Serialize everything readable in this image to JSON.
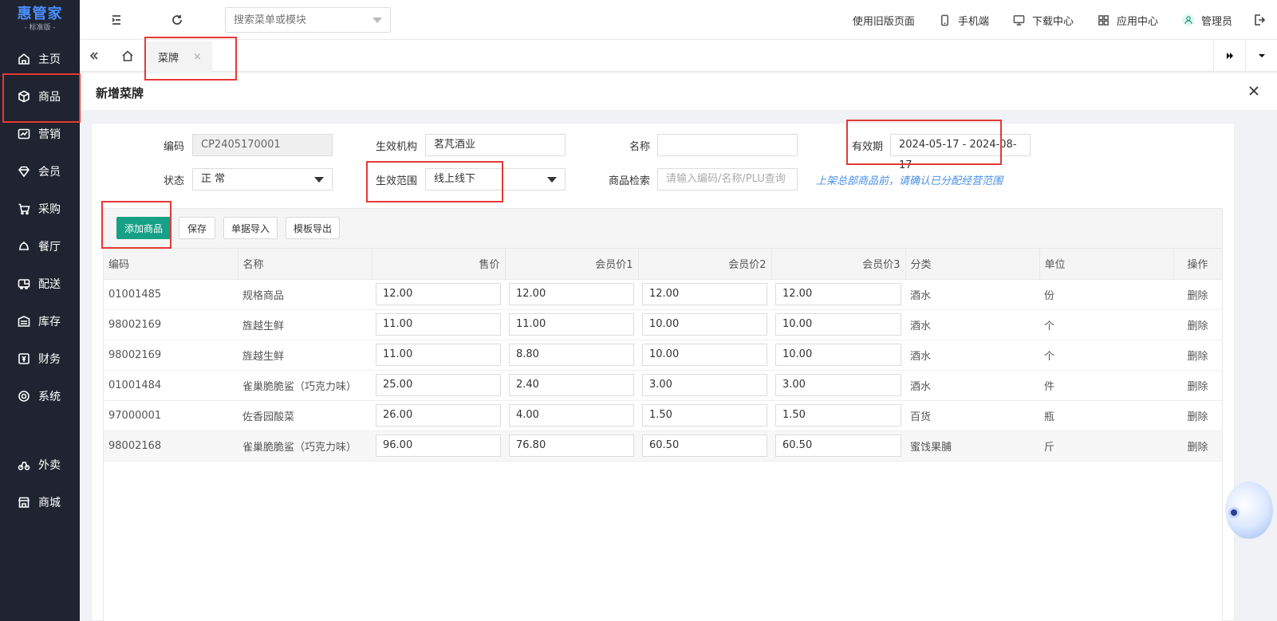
{
  "app": {
    "brand": "惠管家",
    "edition": "- 标准版 -"
  },
  "sidebar": {
    "items": [
      {
        "label": "主页",
        "icon": "home-icon"
      },
      {
        "label": "商品",
        "icon": "box-icon"
      },
      {
        "label": "营销",
        "icon": "chart-icon"
      },
      {
        "label": "会员",
        "icon": "diamond-icon"
      },
      {
        "label": "采购",
        "icon": "cart-icon"
      },
      {
        "label": "餐厅",
        "icon": "bell-icon"
      },
      {
        "label": "配送",
        "icon": "truck-icon"
      },
      {
        "label": "库存",
        "icon": "warehouse-icon"
      },
      {
        "label": "财务",
        "icon": "finance-icon"
      },
      {
        "label": "系统",
        "icon": "settings-icon"
      },
      {
        "label": "外卖",
        "icon": "bike-icon"
      },
      {
        "label": "商城",
        "icon": "store-icon"
      }
    ]
  },
  "topbar": {
    "menu_search_placeholder": "搜索菜单或模块",
    "links": {
      "old_version": "使用旧版页面",
      "mobile": "手机端",
      "download": "下载中心",
      "apps": "应用中心",
      "user": "管理员"
    }
  },
  "tabs": [
    {
      "label": "菜牌",
      "close": "×"
    }
  ],
  "panel": {
    "title": "新增菜牌"
  },
  "form": {
    "code_label": "编码",
    "code_value": "CP2405170001",
    "org_label": "生效机构",
    "org_value": "茗芃酒业",
    "name_label": "名称",
    "name_value": "",
    "validity_label": "有效期",
    "validity_value": "2024-05-17 - 2024-08-17",
    "status_label": "状态",
    "status_value": "正 常",
    "scope_label": "生效范围",
    "scope_value": "线上线下",
    "search_label": "商品检索",
    "search_placeholder": "请输入编码/名称/PLU查询",
    "hint": "上架总部商品前，请确认已分配经营范围"
  },
  "toolbar": {
    "add": "添加商品",
    "save": "保存",
    "import": "单据导入",
    "export": "模板导出"
  },
  "table": {
    "headers": [
      "编码",
      "名称",
      "售价",
      "会员价1",
      "会员价2",
      "会员价3",
      "分类",
      "单位",
      "操作"
    ],
    "rows": [
      {
        "code": "01001485",
        "name": "规格商品",
        "price": "12.00",
        "m1": "12.00",
        "m2": "12.00",
        "m3": "12.00",
        "category": "酒水",
        "unit": "份",
        "op": "删除"
      },
      {
        "code": "98002169",
        "name": "旌越生鲜",
        "price": "11.00",
        "m1": "11.00",
        "m2": "10.00",
        "m3": "10.00",
        "category": "酒水",
        "unit": "个",
        "op": "删除"
      },
      {
        "code": "98002169",
        "name": "旌越生鲜",
        "price": "11.00",
        "m1": "8.80",
        "m2": "10.00",
        "m3": "10.00",
        "category": "酒水",
        "unit": "个",
        "op": "删除"
      },
      {
        "code": "01001484",
        "name": "雀巢脆脆鲨（巧克力味）",
        "price": "25.00",
        "m1": "2.40",
        "m2": "3.00",
        "m3": "3.00",
        "category": "酒水",
        "unit": "件",
        "op": "删除"
      },
      {
        "code": "97000001",
        "name": "佐香园酸菜",
        "price": "26.00",
        "m1": "4.00",
        "m2": "1.50",
        "m3": "1.50",
        "category": "百货",
        "unit": "瓶",
        "op": "删除"
      },
      {
        "code": "98002168",
        "name": "雀巢脆脆鲨（巧克力味）",
        "price": "96.00",
        "m1": "76.80",
        "m2": "60.50",
        "m3": "60.50",
        "category": "蜜饯果脯",
        "unit": "斤",
        "op": "删除"
      }
    ]
  },
  "colors": {
    "sidebar_bg": "#1f2430",
    "primary": "#16a085",
    "danger": "#e03030",
    "highlight": "#e53935",
    "hint": "#4a8fe7"
  }
}
